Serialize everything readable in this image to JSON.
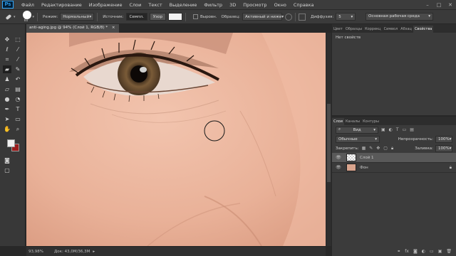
{
  "app": {
    "logo": "Ps"
  },
  "menu": [
    "Файл",
    "Редактирование",
    "Изображение",
    "Слои",
    "Текст",
    "Выделение",
    "Фильтр",
    "3D",
    "Просмотр",
    "Окно",
    "Справка"
  ],
  "window_controls": [
    "–",
    "□",
    "✕"
  ],
  "options": {
    "brush_size": "60",
    "mode_label": "Режим:",
    "mode_value": "Нормальный",
    "source_label": "Источник:",
    "source_sampled": "Семпл.",
    "source_pattern": "Узор",
    "aligned_label": "Выровн.",
    "sample_label": "Образец:",
    "sample_value": "Активный и ниже",
    "diffusion_label": "Диффузия:",
    "diffusion_value": "5",
    "workspace": "Основная рабочая среда"
  },
  "document": {
    "tab_title": "anti-aging.jpg @ 94% (Слой 1, RGB/8) *",
    "tab_close": "×",
    "zoom": "93,98%",
    "doc_size": "Док: 43,0M/36,3M"
  },
  "colors": {
    "foreground": "#f0f0f0",
    "background": "#9a1c1c",
    "skin": "#e8b39a",
    "iris": "#7a5b38"
  },
  "properties_panel": {
    "tabs": [
      "Цвет",
      "Образцы",
      "Коррекц",
      "Символ",
      "Абзац",
      "Свойства"
    ],
    "active_tab": "Свойства",
    "empty_text": "Нет свойств"
  },
  "layers_panel": {
    "tabs": [
      "Слои",
      "Каналы",
      "Контуры"
    ],
    "active_tab": "Слои",
    "filter_label": "Вид",
    "blend_mode": "Обычные",
    "opacity_label": "Непрозрачность:",
    "opacity_value": "100%",
    "lock_label": "Закрепить:",
    "fill_label": "Заливка:",
    "fill_value": "100%",
    "layers": [
      {
        "name": "Слой 1",
        "selected": true,
        "thumb": "transparent",
        "locked": false
      },
      {
        "name": "Фон",
        "selected": false,
        "thumb": "photo",
        "locked": true
      }
    ],
    "footer_icons": [
      "link-icon",
      "fx-icon",
      "mask-icon",
      "adjustment-icon",
      "folder-icon",
      "new-layer-icon",
      "trash-icon"
    ]
  },
  "tools": [
    "move-icon",
    "marquee-icon",
    "lasso-icon",
    "magic-wand-icon",
    "crop-icon",
    "eyedropper-icon",
    "healing-brush-icon",
    "brush-icon",
    "clone-stamp-icon",
    "history-brush-icon",
    "eraser-icon",
    "gradient-icon",
    "blur-icon",
    "dodge-icon",
    "pen-icon",
    "type-icon",
    "path-select-icon",
    "shape-icon",
    "hand-icon",
    "zoom-icon"
  ]
}
